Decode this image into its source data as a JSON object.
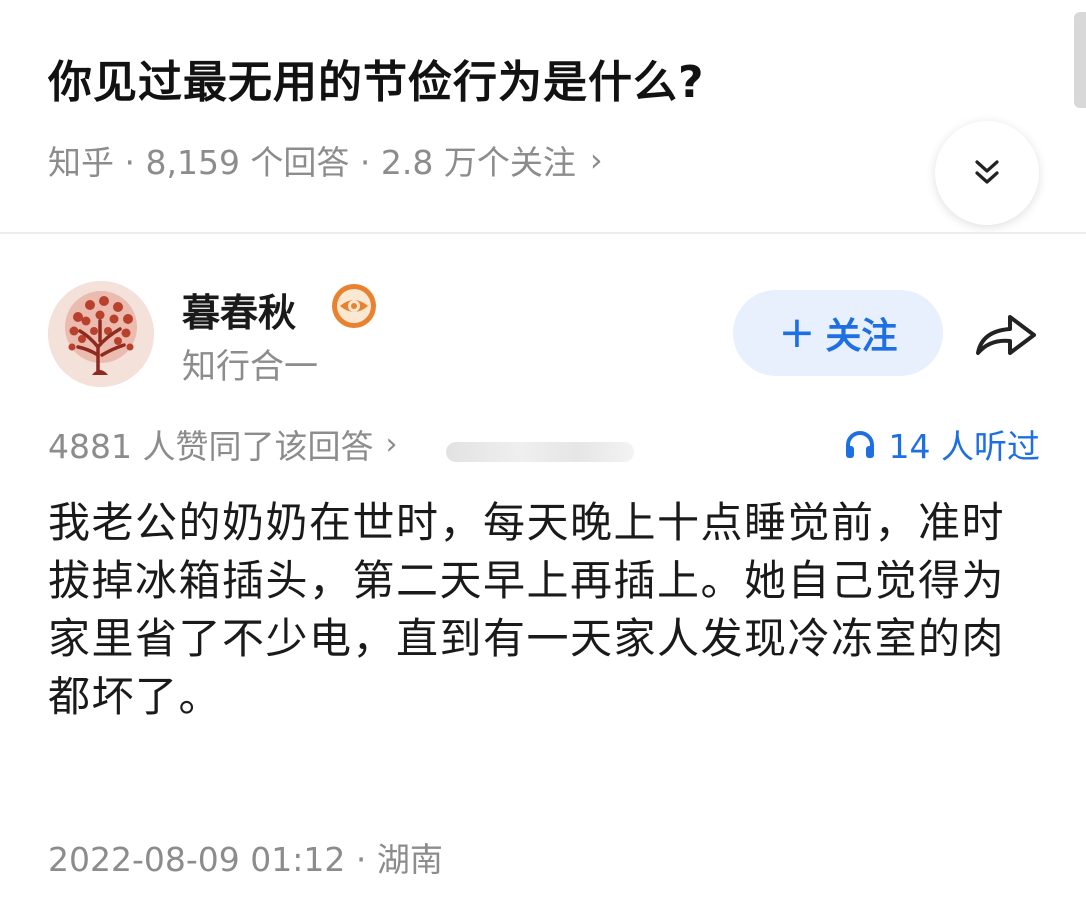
{
  "question": {
    "title": "你见过最无用的节俭行为是什么?",
    "meta": "知乎 · 8,159 个回答 · 2.8 万个关注",
    "meta_chevron": "›",
    "collapse_icon": "double-chevron-down-icon"
  },
  "author": {
    "name": "暮春秋",
    "bio": "知行合一",
    "badge_icon": "eye-badge-icon",
    "follow_label": "关注",
    "follow_plus": "+",
    "share_icon": "share-arrow-icon"
  },
  "answer": {
    "votes": "4881 人赞同了该回答",
    "votes_chevron": "›",
    "listen_text": "14 人听过",
    "listen_icon": "headphones-icon",
    "content": "我老公的奶奶在世时，每天晚上十点睡觉前，准时拔掉冰箱插头，第二天早上再插上。她自己觉得为家里省了不少电，直到有一天家人发现冷冻室的肉都坏了。",
    "timestamp": "2022-08-09 01:12 · 湖南"
  },
  "colors": {
    "accent": "#1d6fe3",
    "follow_bg": "#e8f0fd",
    "muted_text": "#8c8c8c",
    "badge_orange": "#e8822e"
  }
}
